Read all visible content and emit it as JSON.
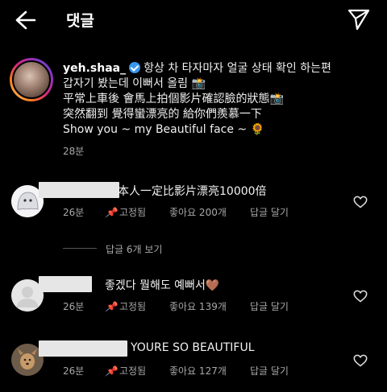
{
  "header": {
    "title": "댓글",
    "back_icon": "arrow-left-icon",
    "send_icon": "paper-plane-icon"
  },
  "caption": {
    "username": "yeh.shaa_",
    "lines": [
      "항상 차 타자마자 얼굴 상태 확인 하는편",
      "갑자기 봤는데 이뻐서 올림 📸",
      "平常上車後 會馬上拍個影片確認臉的狀態📸",
      "突然翻到 覺得蠻漂亮的 給你們羨慕一下",
      "Show you ~ my Beautiful face ~ 🌻"
    ],
    "time": "28분"
  },
  "comments": [
    {
      "text": "本人一定比影片漂亮10000倍",
      "time": "26분",
      "pinned": "고정됨",
      "likes": "좋아요 200개",
      "reply": "답글 달기"
    },
    {
      "text": "좋겠다 뭘해도 예뻐서🤎",
      "time": "26분",
      "pinned": "고정됨",
      "likes": "좋아요 139개",
      "reply": "답글 달기"
    },
    {
      "text": "YOURE SO BEAUTIFUL",
      "time": "26분",
      "pinned": "고정됨",
      "likes": "좋아요 127개",
      "reply": "답글 달기"
    }
  ],
  "view_replies": "답글 6개 보기",
  "colors": {
    "background": "#000000",
    "secondary_text": "#a8a8a8",
    "verified": "#3897f0"
  }
}
